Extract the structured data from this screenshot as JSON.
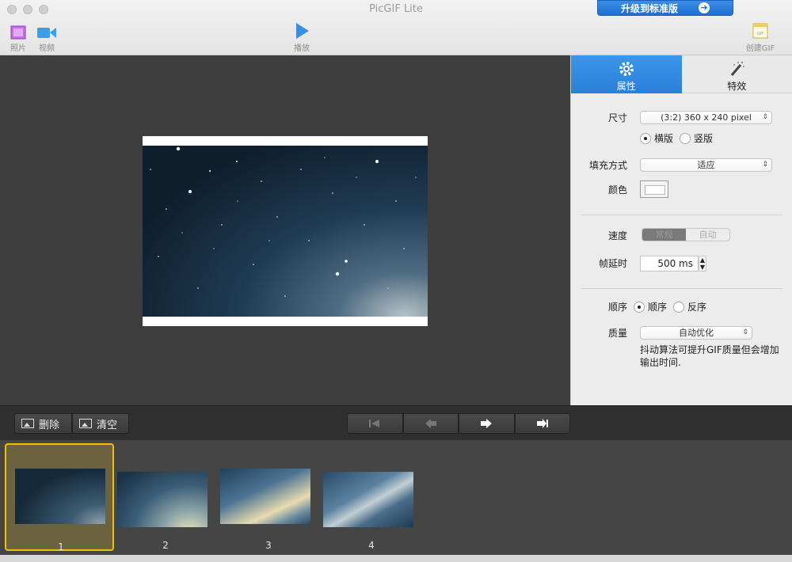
{
  "window": {
    "title": "PicGIF Lite",
    "upgrade_label": "升级到标准版"
  },
  "toolbar": {
    "photo": "照片",
    "video": "视频",
    "play": "播放",
    "create_gif": "创建GIF",
    "gif_badge": "GIF"
  },
  "panel": {
    "tabs": [
      {
        "label": "属性"
      },
      {
        "label": "特效"
      }
    ],
    "size_label": "尺寸",
    "size_value": "(3:2) 360 x 240 pixel",
    "orientation": {
      "landscape": "横版",
      "portrait": "竖版",
      "selected": "landscape"
    },
    "fill_label": "填充方式",
    "fill_value": "适应",
    "color_label": "颜色",
    "speed_label": "速度",
    "speed_options": [
      "常规",
      "自动"
    ],
    "delay_label": "帧延时",
    "delay_value": "500 ms",
    "order_label": "顺序",
    "order": {
      "forward": "顺序",
      "reverse": "反序",
      "selected": "forward"
    },
    "quality_label": "质量",
    "quality_value": "自动优化",
    "quality_note": "抖动算法可提升GIF质量但会增加输出时间."
  },
  "controls": {
    "delete": "删除",
    "clear": "清空"
  },
  "frames": [
    {
      "label": "1"
    },
    {
      "label": "2"
    },
    {
      "label": "3"
    },
    {
      "label": "4"
    }
  ],
  "colors": {
    "accent": "#2a7fd8",
    "selected_frame": "#f2c000",
    "preview_bg": "#3d3d3d"
  }
}
